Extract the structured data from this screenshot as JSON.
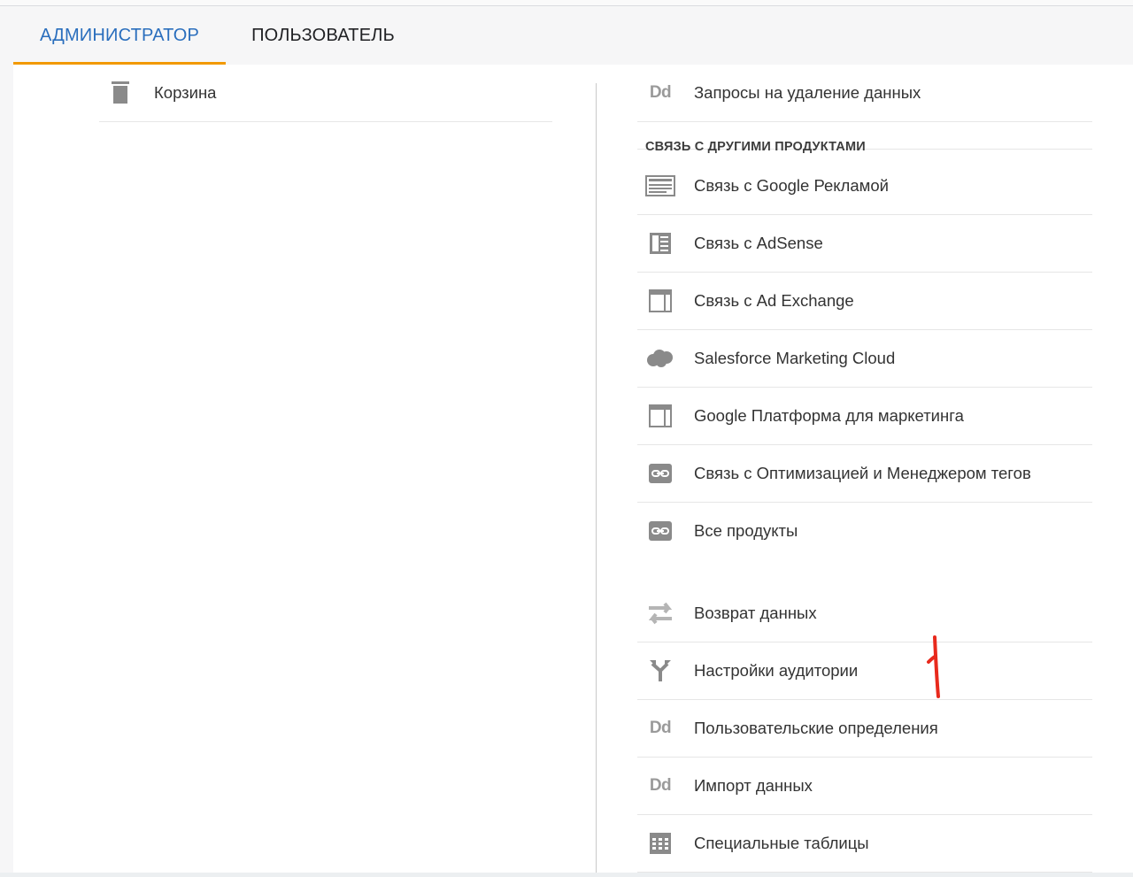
{
  "tabs": [
    {
      "label": "АДМИНИСТРАТОР",
      "active": true
    },
    {
      "label": "ПОЛЬЗОВАТЕЛЬ",
      "active": false
    }
  ],
  "left_column": {
    "items": [
      {
        "label": "Корзина",
        "icon": "trash-icon"
      }
    ]
  },
  "right_column": {
    "top_item": {
      "label": "Запросы на удаление данных",
      "icon": "dd-icon"
    },
    "section_header": "СВЯЗЬ С ДРУГИМИ ПРОДУКТАМИ",
    "product_links": [
      {
        "label": "Связь с Google Рекламой",
        "icon": "google-ads-icon"
      },
      {
        "label": "Связь с AdSense",
        "icon": "adsense-icon"
      },
      {
        "label": "Связь с Ad Exchange",
        "icon": "ad-exchange-icon"
      },
      {
        "label": "Salesforce Marketing Cloud",
        "icon": "cloud-icon"
      },
      {
        "label": "Google Платформа для маркетинга",
        "icon": "marketing-platform-icon"
      },
      {
        "label": "Связь с Оптимизацией и Менеджером тегов",
        "icon": "link-icon"
      },
      {
        "label": "Все продукты",
        "icon": "link-icon"
      }
    ],
    "other_items": [
      {
        "label": "Возврат данных",
        "icon": "data-return-icon"
      },
      {
        "label": "Настройки аудитории",
        "icon": "audience-fork-icon"
      },
      {
        "label": "Пользовательские определения",
        "icon": "dd-icon"
      },
      {
        "label": "Импорт данных",
        "icon": "dd-icon"
      },
      {
        "label": "Специальные таблицы",
        "icon": "table-grid-icon"
      }
    ]
  },
  "annotation": {
    "text": "1",
    "color": "#e8291c"
  },
  "colors": {
    "active_tab": "#2a6ebd",
    "tab_underline": "#f29900",
    "icon_gray": "#8a8a8a"
  }
}
